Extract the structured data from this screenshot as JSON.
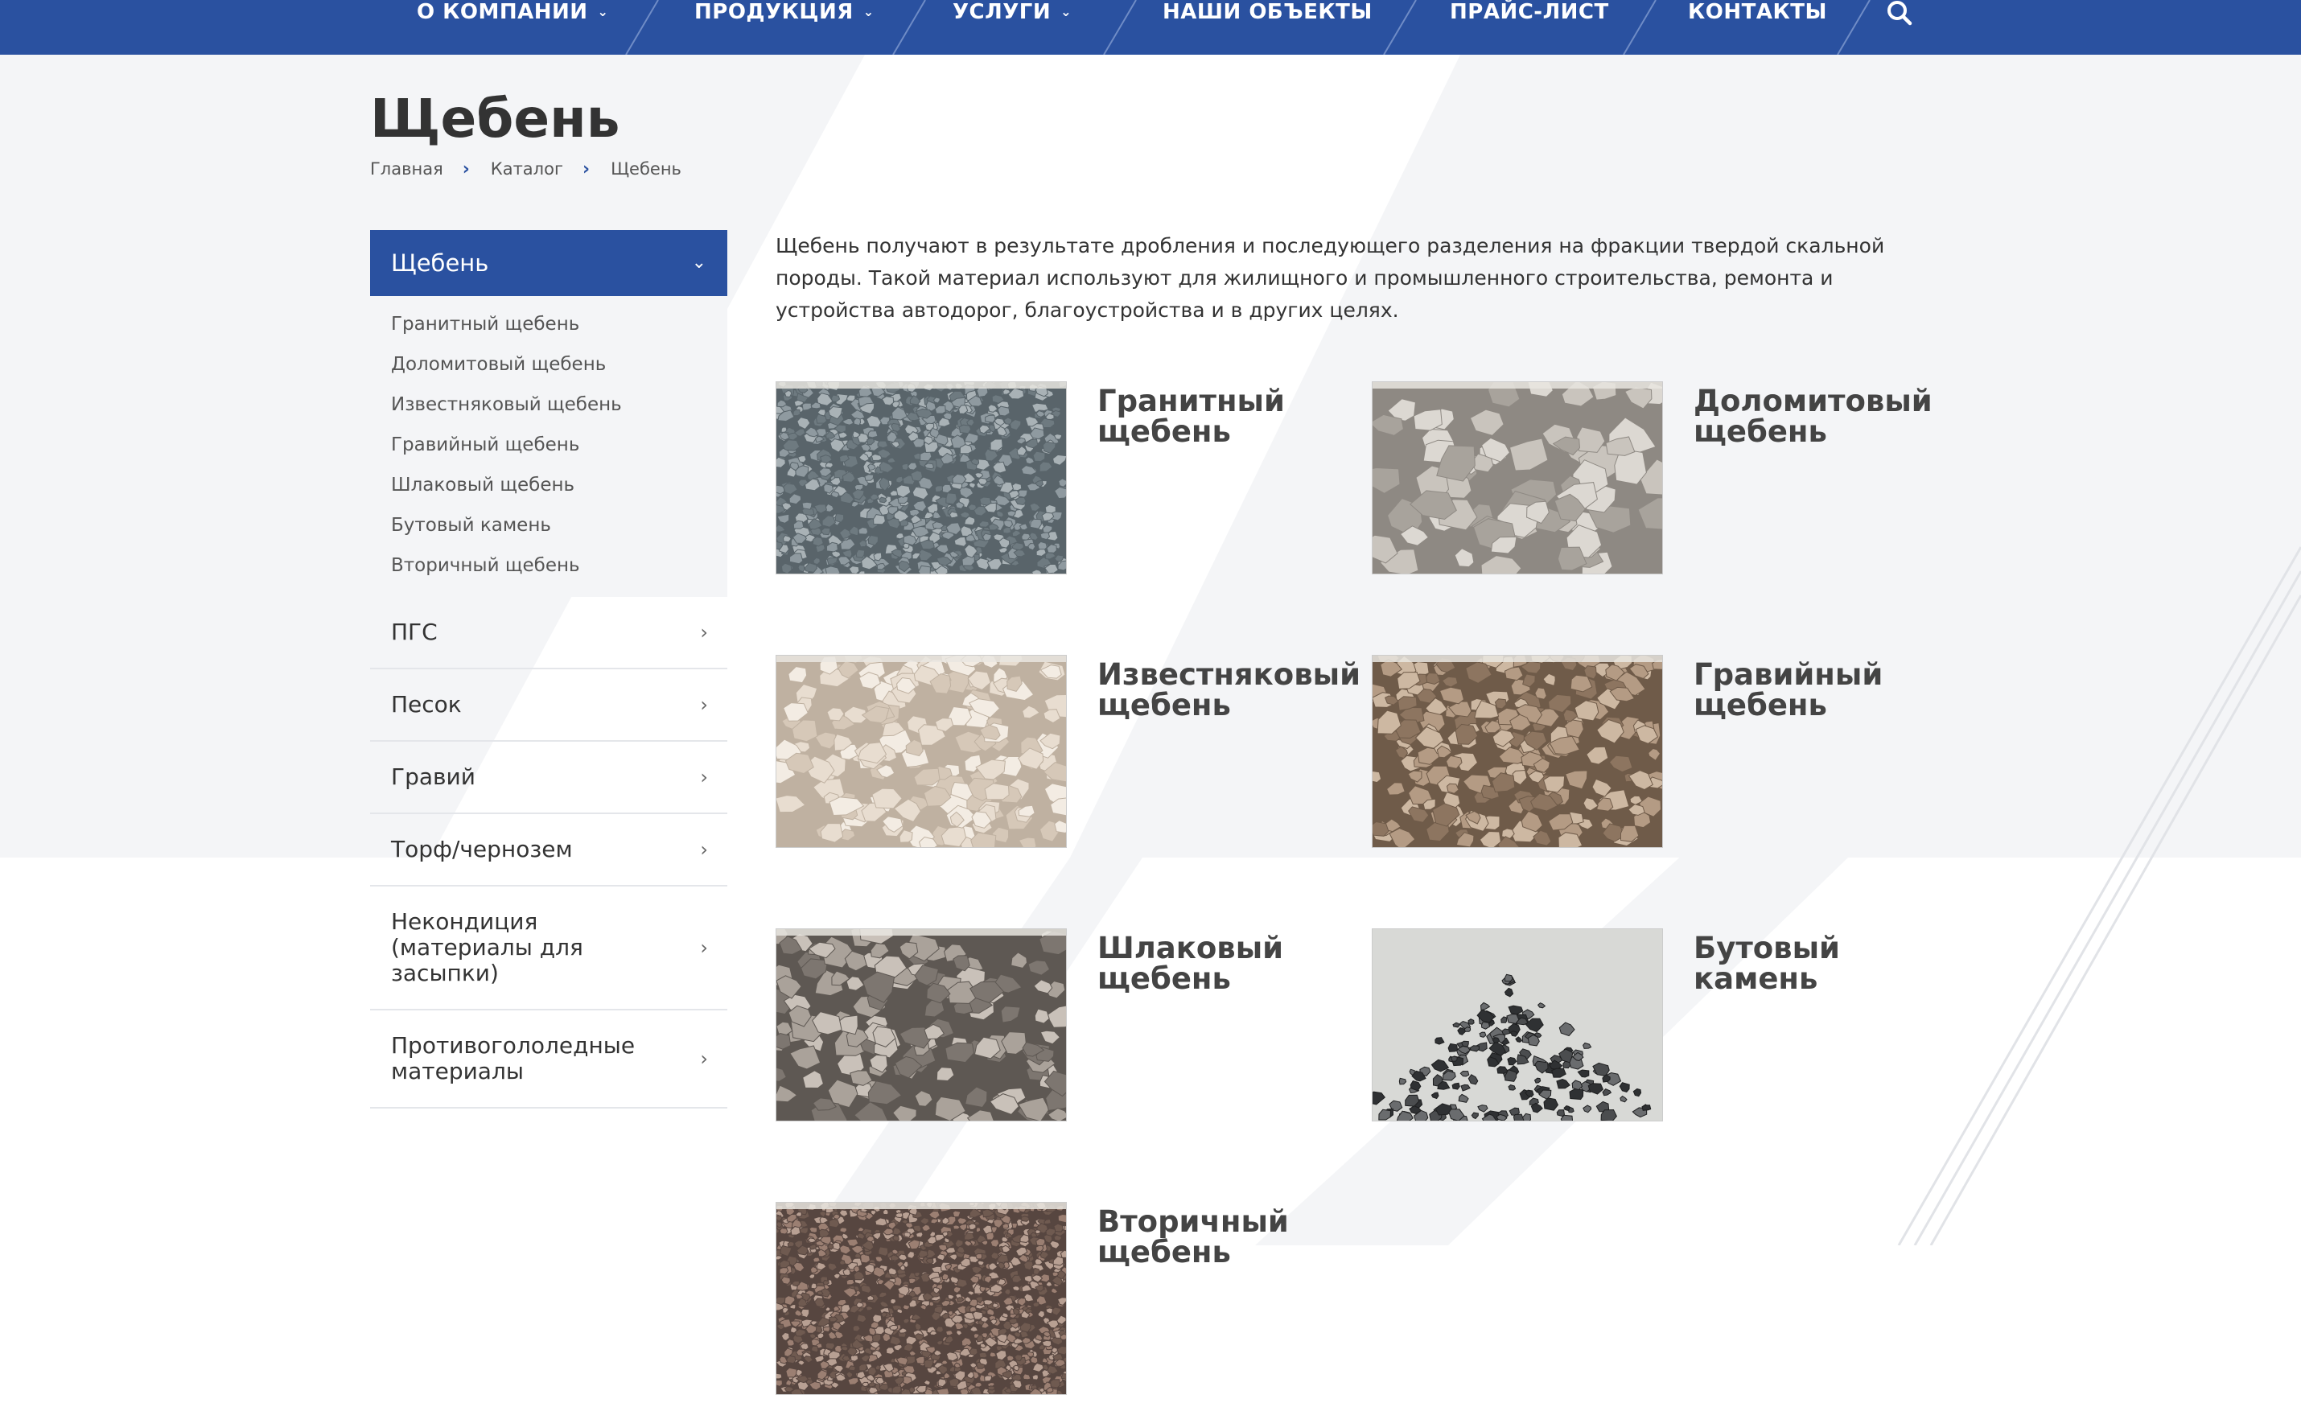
{
  "nav": {
    "items": [
      {
        "label": "О КОМПАНИИ",
        "dropdown": true
      },
      {
        "label": "ПРОДУКЦИЯ",
        "dropdown": true
      },
      {
        "label": "УСЛУГИ",
        "dropdown": true
      },
      {
        "label": "НАШИ ОБЪЕКТЫ",
        "dropdown": false
      },
      {
        "label": "ПРАЙС-ЛИСТ",
        "dropdown": false
      },
      {
        "label": "КОНТАКТЫ",
        "dropdown": false
      }
    ],
    "chevron_glyph": "⌄",
    "search_icon": "search-icon",
    "color": "#2a51a0"
  },
  "page": {
    "title": "Щебень"
  },
  "breadcrumb": {
    "items": [
      "Главная",
      "Каталог",
      "Щебень"
    ],
    "separator": "›"
  },
  "sidebar": {
    "active": {
      "label": "Щебень",
      "arrow": "⌄"
    },
    "sub_items": [
      "Гранитный щебень",
      "Доломитовый щебень",
      "Известняковый щебень",
      "Гравийный щебень",
      "Шлаковый щебень",
      "Бутовый камень",
      "Вторичный щебень"
    ],
    "items": [
      "ПГС",
      "Песок",
      "Гравий",
      "Торф/чернозем",
      "Некондиция (материалы для засыпки)",
      "Противогололедные материалы"
    ],
    "item_arrow": "›"
  },
  "intro": "Щебень получают в результате дробления и последующего разделения на фракции твердой скальной породы. Такой материал используют для жилищного и промышленного строительства, ремонта и устройства автодорог, благоустройства и в других целях.",
  "products": [
    {
      "title": "Гранитный щебень",
      "palette": [
        "#8f9aa0",
        "#6e7a80",
        "#a9b2b6",
        "#59646a"
      ]
    },
    {
      "title": "Доломитовый щебень",
      "palette": [
        "#c9c4bd",
        "#a8a39c",
        "#dcd8d2",
        "#8e8983"
      ]
    },
    {
      "title": "Известняковый щебень",
      "palette": [
        "#e8ddd0",
        "#d6c8b8",
        "#f3ece3",
        "#bfb1a1"
      ]
    },
    {
      "title": "Гравийный щебень",
      "palette": [
        "#b49b84",
        "#8d7560",
        "#cdb8a2",
        "#6f5b49"
      ]
    },
    {
      "title": "Шлаковый щебень",
      "palette": [
        "#aaa29a",
        "#7d7670",
        "#c9c1b9",
        "#5e5853"
      ]
    },
    {
      "title": "Бутовый камень",
      "palette": [
        "#4b4d4f",
        "#2f3133",
        "#6a6c6e",
        "#1e1f20"
      ]
    },
    {
      "title": "Вторичный щебень",
      "palette": [
        "#9b7f72",
        "#6f5a50",
        "#b8a093",
        "#574640"
      ]
    }
  ]
}
